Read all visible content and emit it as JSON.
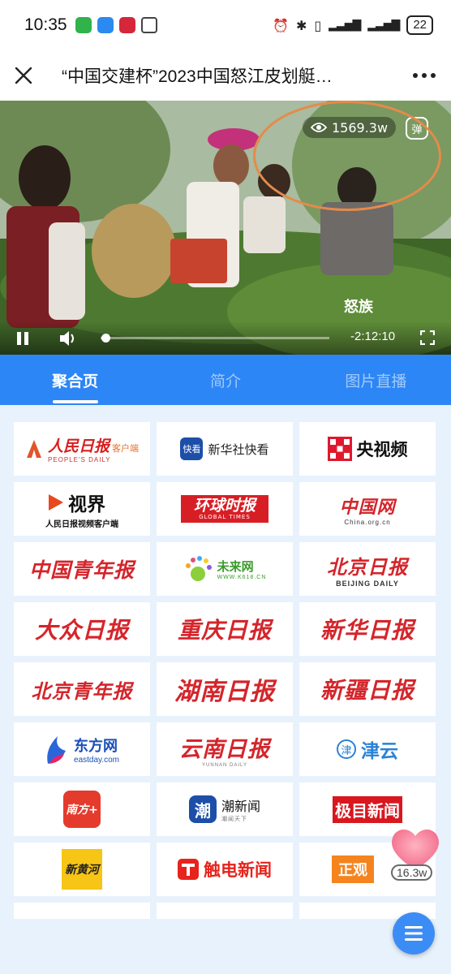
{
  "status_bar": {
    "time": "10:35",
    "battery": "22",
    "network": "4G"
  },
  "header": {
    "title": "“中国交建杯”2023中国怒江皮划艇…"
  },
  "video": {
    "views": "1569.3w",
    "danmu_label": "弹",
    "caption": "怒族",
    "time_remaining": "-2:12:10",
    "progress": 0.02
  },
  "tabs": [
    {
      "label": "聚合页",
      "active": true
    },
    {
      "label": "简介",
      "active": false
    },
    {
      "label": "图片直播",
      "active": false
    }
  ],
  "media": {
    "renmin": {
      "name": "人民日报",
      "suffix": "客户端",
      "sub": "PEOPLE'S DAILY"
    },
    "xinhua_kuaikan": {
      "badge": "快看",
      "name": "新华社快看"
    },
    "cctv": {
      "name": "央视频"
    },
    "shijie": {
      "name": "视界",
      "sub": "人民日报视频客户端"
    },
    "huanqiu": {
      "name": "环球时报",
      "sub": "GLOBAL TIMES"
    },
    "china_com": {
      "name": "中国网",
      "sub": "China.org.cn"
    },
    "qingnian": {
      "name": "中国青年报"
    },
    "weilai": {
      "name": "未来网",
      "sub": "WWW.K618.CN"
    },
    "beijing_daily": {
      "name": "北京日报",
      "sub": "BEIJING DAILY"
    },
    "dazhong": {
      "name": "大众日报"
    },
    "chongqing": {
      "name": "重庆日报"
    },
    "xinhua_daily": {
      "name": "新华日报"
    },
    "bj_youth": {
      "name": "北京青年报"
    },
    "hunan": {
      "name": "湖南日报"
    },
    "xinjiang": {
      "name": "新疆日报"
    },
    "eastday": {
      "name": "东方网",
      "sub": "eastday.com"
    },
    "yunnan": {
      "name": "云南日报",
      "sub": "YUNNAN DAILY"
    },
    "jinyun": {
      "name": "津云",
      "badge": "津"
    },
    "nanfang": {
      "name": "南方+"
    },
    "chao": {
      "badge": "潮",
      "name": "潮新闻",
      "sub": "潮闻天下"
    },
    "jimu": {
      "name": "极目新闻"
    },
    "xinhuanghe": {
      "name": "新黄河"
    },
    "chudian": {
      "name": "触电新闻"
    },
    "zhengguan": {
      "name": "正观"
    }
  },
  "likes": {
    "count": "16.3w"
  },
  "colors": {
    "accent": "#2d86f5",
    "grid_bg": "#e8f2fd",
    "annotation": "#e68a4a"
  }
}
